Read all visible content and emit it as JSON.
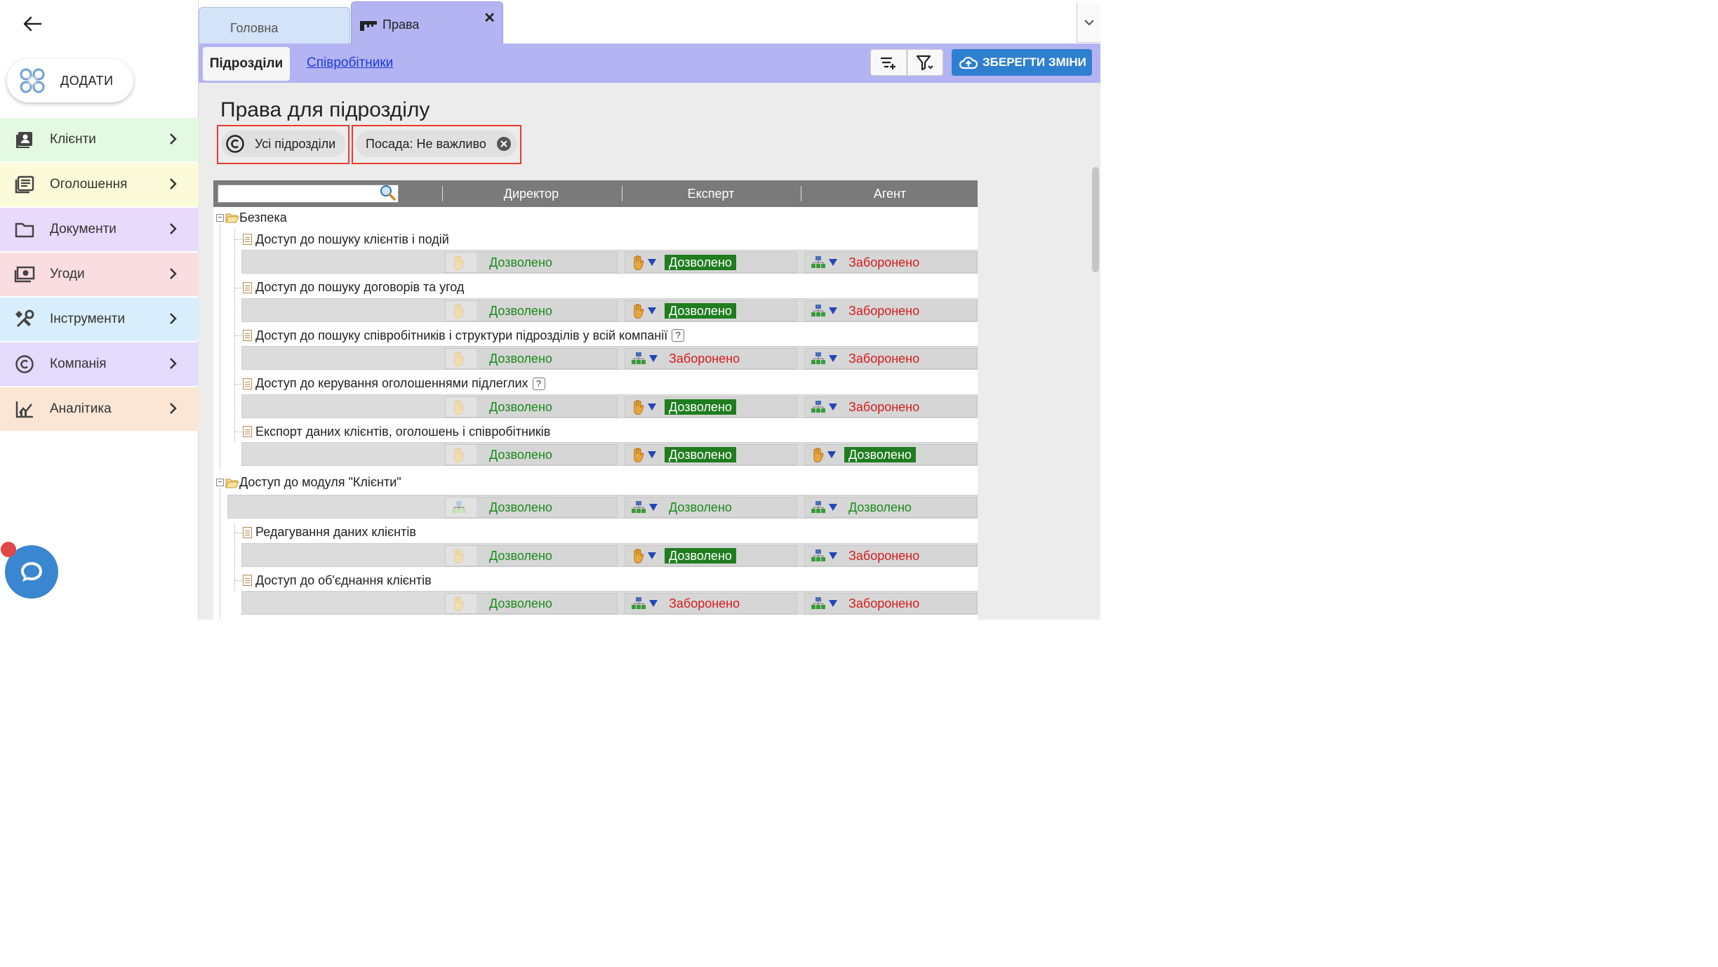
{
  "sidebar": {
    "add_label": "ДОДАТИ",
    "items": [
      {
        "label": "Клієнти",
        "icon": "contacts-icon",
        "color": "#e3f9e1"
      },
      {
        "label": "Оголошення",
        "icon": "listings-icon",
        "color": "#fbfbd9"
      },
      {
        "label": "Документи",
        "icon": "folder-icon",
        "color": "#e8dafb"
      },
      {
        "label": "Угоди",
        "icon": "deal-icon",
        "color": "#fadde0"
      },
      {
        "label": "Інструменти",
        "icon": "tools-icon",
        "color": "#d9eefd"
      },
      {
        "label": "Компанія",
        "icon": "company-icon",
        "color": "#e2dbfb"
      },
      {
        "label": "Аналітика",
        "icon": "analytics-icon",
        "color": "#fbe6d6"
      }
    ]
  },
  "tabs": {
    "home": "Головна",
    "rights": "Права",
    "close": "✕"
  },
  "subnav": {
    "active": "Підрозділи",
    "link": "Співробітники",
    "save": "ЗБЕРЕГТИ ЗМІНИ"
  },
  "page": {
    "title": "Права для підрозділу",
    "chip_units": "Усі підрозділи",
    "chip_position": "Посада: Не важливо"
  },
  "grid": {
    "search_placeholder": "",
    "columns": [
      "Директор",
      "Експерт",
      "Агент"
    ],
    "groups": [
      {
        "title": "Безпека",
        "items": [
          {
            "title": "Доступ до пошуку клієнтів і подій",
            "help": false,
            "cells": [
              {
                "icon": "hand",
                "ghost": true,
                "text": "Дозволено",
                "style": "allowed"
              },
              {
                "icon": "hand",
                "ghost": false,
                "text": "Дозволено",
                "style": "allowed-hl"
              },
              {
                "icon": "org",
                "ghost": false,
                "text": "Заборонено",
                "style": "denied"
              }
            ]
          },
          {
            "title": "Доступ до пошуку договорів та угод",
            "help": false,
            "cells": [
              {
                "icon": "hand",
                "ghost": true,
                "text": "Дозволено",
                "style": "allowed"
              },
              {
                "icon": "hand",
                "ghost": false,
                "text": "Дозволено",
                "style": "allowed-hl"
              },
              {
                "icon": "org",
                "ghost": false,
                "text": "Заборонено",
                "style": "denied"
              }
            ]
          },
          {
            "title": "Доступ до пошуку співробітників і структури підрозділів у всій компанії",
            "help": true,
            "cells": [
              {
                "icon": "hand",
                "ghost": true,
                "text": "Дозволено",
                "style": "allowed"
              },
              {
                "icon": "org",
                "ghost": false,
                "text": "Заборонено",
                "style": "denied"
              },
              {
                "icon": "org",
                "ghost": false,
                "text": "Заборонено",
                "style": "denied"
              }
            ]
          },
          {
            "title": "Доступ до керування оголошеннями підлеглих",
            "help": true,
            "cells": [
              {
                "icon": "hand",
                "ghost": true,
                "text": "Дозволено",
                "style": "allowed"
              },
              {
                "icon": "hand",
                "ghost": false,
                "text": "Дозволено",
                "style": "allowed-hl"
              },
              {
                "icon": "org",
                "ghost": false,
                "text": "Заборонено",
                "style": "denied"
              }
            ]
          },
          {
            "title": "Експорт даних клієнтів, оголошень і співробітників",
            "help": false,
            "cells": [
              {
                "icon": "hand",
                "ghost": true,
                "text": "Дозволено",
                "style": "allowed"
              },
              {
                "icon": "hand",
                "ghost": false,
                "text": "Дозволено",
                "style": "allowed-hl"
              },
              {
                "icon": "hand",
                "ghost": false,
                "text": "Дозволено",
                "style": "allowed-hl"
              }
            ]
          }
        ]
      },
      {
        "title": "Доступ до модуля \"Клієнти\"",
        "cells": [
          {
            "icon": "org",
            "ghost": true,
            "text": "Дозволено",
            "style": "allowed"
          },
          {
            "icon": "org",
            "ghost": false,
            "text": "Дозволено",
            "style": "allowed"
          },
          {
            "icon": "org",
            "ghost": false,
            "text": "Дозволено",
            "style": "allowed"
          }
        ],
        "items": [
          {
            "title": "Редагування даних клієнтів",
            "help": false,
            "cells": [
              {
                "icon": "hand",
                "ghost": true,
                "text": "Дозволено",
                "style": "allowed"
              },
              {
                "icon": "hand",
                "ghost": false,
                "text": "Дозволено",
                "style": "allowed-hl"
              },
              {
                "icon": "org",
                "ghost": false,
                "text": "Заборонено",
                "style": "denied"
              }
            ]
          },
          {
            "title": "Доступ до об'єднання клієнтів",
            "help": false,
            "cells": [
              {
                "icon": "hand",
                "ghost": true,
                "text": "Дозволено",
                "style": "allowed"
              },
              {
                "icon": "org",
                "ghost": false,
                "text": "Заборонено",
                "style": "denied"
              },
              {
                "icon": "org",
                "ghost": false,
                "text": "Заборонено",
                "style": "denied"
              }
            ]
          }
        ]
      }
    ],
    "help_mark": "?"
  },
  "colors": {
    "accent": "#b4b4f2",
    "save": "#2f7fd0",
    "allowed": "#1c8a1c",
    "denied": "#d81c1c",
    "highlight": "#e53d2e"
  }
}
